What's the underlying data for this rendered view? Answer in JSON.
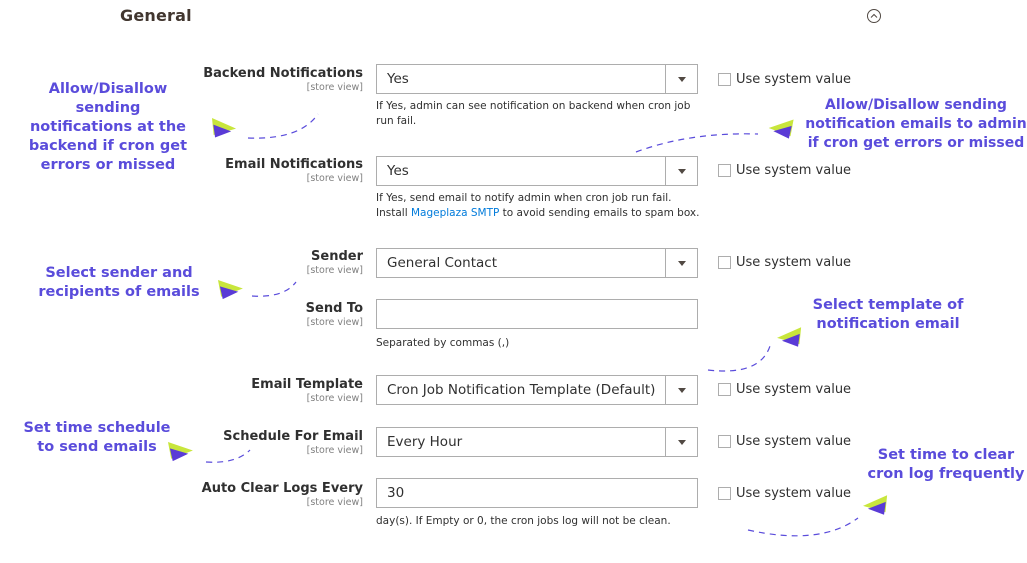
{
  "section": {
    "title": "General"
  },
  "system_value_label": "Use system value",
  "fields": {
    "backend": {
      "label": "Backend Notifications",
      "scope": "[store view]",
      "value": "Yes",
      "note": "If Yes, admin can see notification on backend when cron job run fail."
    },
    "email": {
      "label": "Email Notifications",
      "scope": "[store view]",
      "value": "Yes",
      "note_1": "If Yes, send email to notify admin when cron job run fail.",
      "note_2_pre": "Install ",
      "note_2_link": "Mageplaza SMTP",
      "note_2_post": " to avoid sending emails to spam box."
    },
    "sender": {
      "label": "Sender",
      "scope": "[store view]",
      "value": "General Contact"
    },
    "send_to": {
      "label": "Send To",
      "scope": "[store view]",
      "value": "",
      "note": "Separated by commas (,)"
    },
    "template": {
      "label": "Email Template",
      "scope": "[store view]",
      "value": "Cron Job Notification Template (Default)"
    },
    "schedule": {
      "label": "Schedule For Email",
      "scope": "[store view]",
      "value": "Every Hour"
    },
    "clear_logs": {
      "label": "Auto Clear Logs Every",
      "scope": "[store view]",
      "value": "30",
      "note": "day(s). If Empty or 0, the cron jobs log will not be clean."
    }
  },
  "annotations": {
    "backend": "Allow/Disallow sending\nnotifications at the\nbackend if cron get\nerrors or missed",
    "email": "Allow/Disallow sending\nnotification emails to admin\nif cron get errors or missed",
    "sender": "Select sender and\nrecipients of emails",
    "template": "Select template of\nnotification email",
    "schedule": "Set time schedule\nto send emails",
    "clear": "Set time to clear\ncron log frequently"
  },
  "colors": {
    "annotation": "#5a4cdb",
    "link": "#007bdb",
    "pointer_yellow": "#c8e63c"
  }
}
